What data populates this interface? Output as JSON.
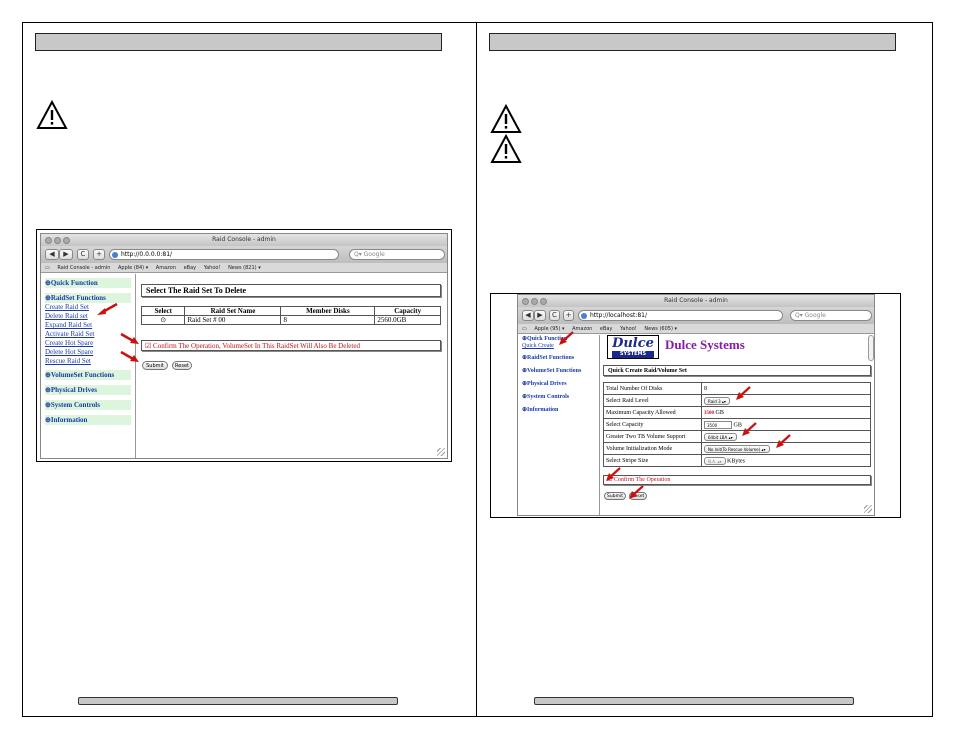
{
  "left": {
    "browser": {
      "window_title": "Raid Console - admin",
      "url": "http://0.0.0.0:81/",
      "search_placeholder": "Google",
      "back": "◀",
      "forward": "▶",
      "reload": "C",
      "add": "+",
      "bookmarks": [
        "Raid Console - admin",
        "Apple (84) ▾",
        "Amazon",
        "eBay",
        "Yahoo!",
        "News (821) ▾"
      ]
    },
    "sidebar": {
      "quick_function": "⊕Quick Function",
      "raidset_functions": "⊕RaidSet Functions",
      "raidset_items": [
        "Create Raid Set",
        "Delete Raid set",
        "Expand Raid Set",
        "Activate Raid Set",
        "Create Hot Spare",
        "Delete Hot Spare",
        "Rescue Raid Set"
      ],
      "volumeset_functions": "⊕VolumeSet Functions",
      "physical_drives": "⊕Physical Drives",
      "system_controls": "⊕System Controls",
      "information": "⊕Information"
    },
    "content": {
      "box_title": "Select The Raid Set To Delete",
      "table_headers": [
        "Select",
        "Raid Set Name",
        "Member Disks",
        "Capacity"
      ],
      "table_rows": [
        {
          "select": "⊙",
          "name": "Raid Set # 00",
          "disks": "8",
          "capacity": "2560.0GB"
        }
      ],
      "confirm_text": "Confirm The Operation, VolumeSet In This RaidSet Will Also Be Deleted",
      "submit": "Submit",
      "reset": "Reset"
    }
  },
  "right": {
    "browser": {
      "window_title": "Raid Console - admin",
      "url": "http://localhost:81/",
      "search_placeholder": "Google",
      "back": "◀",
      "forward": "▶",
      "reload": "C",
      "add": "+",
      "bookmarks": [
        "Apple (95) ▾",
        "Amazon",
        "eBay",
        "Yahoo!",
        "News (605) ▾"
      ]
    },
    "logo": {
      "top": "Dulce",
      "bottom": "SYSTEMS",
      "company": "Dulce Systems"
    },
    "sidebar": {
      "quick_function": "⊕Quick Function",
      "quick_create": "Quick Create",
      "raidset_functions": "⊕RaidSet Functions",
      "volumeset_functions": "⊕VolumeSet Functions",
      "physical_drives": "⊕Physical Drives",
      "system_controls": "⊕System Controls",
      "information": "⊕Information"
    },
    "content": {
      "box_title": "Quick Create Raid/Volume Set",
      "rows": [
        {
          "label": "Total Number Of Disks",
          "value": "8"
        },
        {
          "label": "Select Raid Level",
          "value": "Raid 3"
        },
        {
          "label": "Maximum Capacity Allowed",
          "value": "3500",
          "unit": "GB"
        },
        {
          "label": "Select Capacity",
          "value": "3500",
          "unit": "GB"
        },
        {
          "label": "Greater Two TB Volume Support",
          "value": "64bit LBA"
        },
        {
          "label": "Volume Initialization Mode",
          "value": "No Init(To Rescue Volume)"
        },
        {
          "label": "Select Stripe Size",
          "value": "N.A.",
          "unit": "KBytes"
        }
      ],
      "confirm_text": "Confirm The Operation",
      "submit": "Submit",
      "reset": "Reset"
    }
  },
  "colors": {
    "nav_link": "#1a3aa8",
    "nav_head_bg": "#ddf5dd",
    "confirm_red": "#c0101a",
    "logo_purple": "#8a1aa8",
    "arrow_red": "#cc1010"
  }
}
